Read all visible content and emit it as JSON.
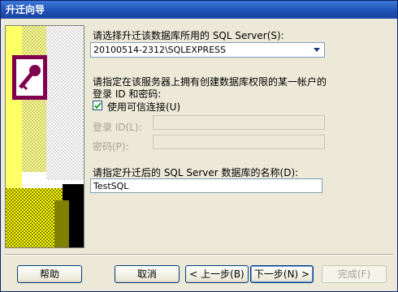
{
  "window": {
    "title": "升迁向导"
  },
  "form": {
    "server_label": "请选择升迁该数据库所用的 SQL Server(S):",
    "server_value": "20100514-2312\\SQLEXPRESS",
    "account_label_1": "请指定在该服务器上拥有创建数据库权限的某一帐户的",
    "account_label_2": "登录 ID 和密码:",
    "trusted_label": "使用可信连接(U)",
    "trusted_checked": true,
    "login_label": "登录 ID(L):",
    "password_label": "密码(P):",
    "dbname_label": "请指定升迁后的 SQL Server 数据库的名称(D):",
    "dbname_value": "TestSQL"
  },
  "buttons": {
    "help": "帮助",
    "cancel": "取消",
    "back": "< 上一步(B)",
    "next": "下一步(N) >",
    "finish": "完成(F)"
  }
}
